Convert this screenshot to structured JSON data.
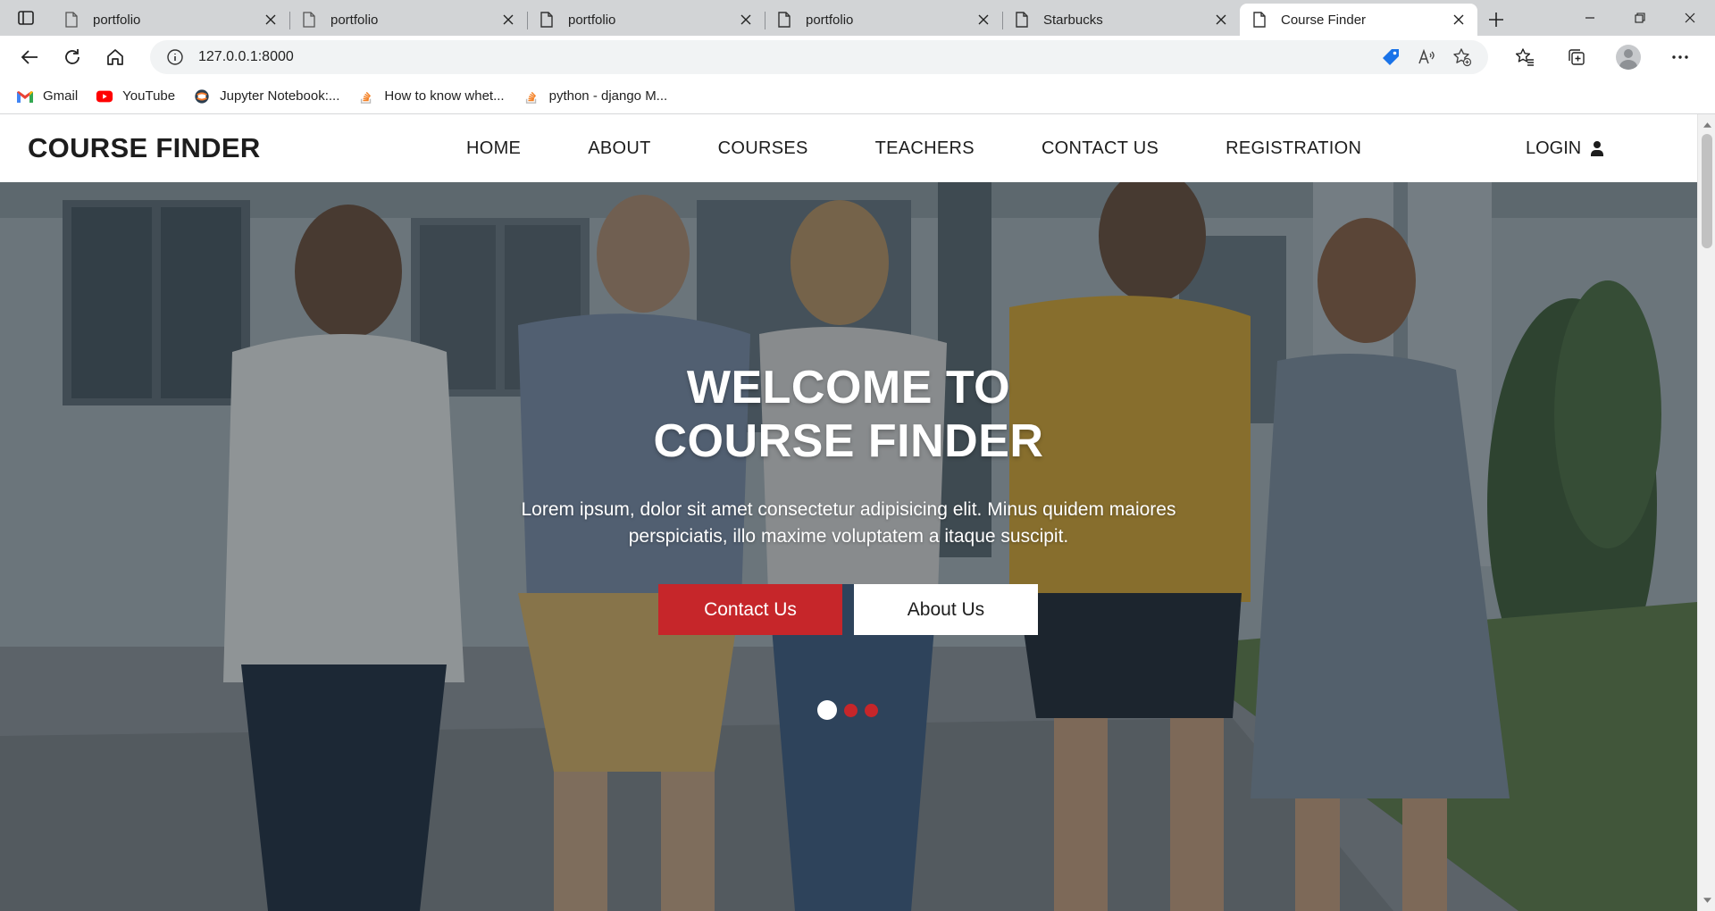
{
  "browser": {
    "tabs": [
      {
        "title": "portfolio",
        "icon": "page-icon",
        "active": false
      },
      {
        "title": "portfolio",
        "icon": "page-icon",
        "active": false
      },
      {
        "title": "portfolio",
        "icon": "page-icon",
        "active": false
      },
      {
        "title": "portfolio",
        "icon": "page-icon",
        "active": false
      },
      {
        "title": "Starbucks",
        "icon": "page-icon",
        "active": false
      },
      {
        "title": "Course Finder",
        "icon": "page-icon",
        "active": true
      }
    ],
    "address": {
      "url": "127.0.0.1:8000"
    },
    "bookmarks": [
      {
        "label": "Gmail",
        "icon": "gmail-icon"
      },
      {
        "label": "YouTube",
        "icon": "youtube-icon"
      },
      {
        "label": "Jupyter Notebook:...",
        "icon": "jupyter-icon"
      },
      {
        "label": "How to know whet...",
        "icon": "stackoverflow-icon"
      },
      {
        "label": "python - django M...",
        "icon": "stackoverflow-icon"
      }
    ]
  },
  "site": {
    "brand": "COURSE FINDER",
    "menu": [
      {
        "label": "HOME"
      },
      {
        "label": "ABOUT"
      },
      {
        "label": "COURSES"
      },
      {
        "label": "TEACHERS"
      },
      {
        "label": "CONTACT US"
      },
      {
        "label": "REGISTRATION"
      }
    ],
    "login": {
      "label": "LOGIN",
      "icon": "user-icon"
    },
    "hero": {
      "title_line1": "WELCOME TO",
      "title_line2": "COURSE FINDER",
      "text_line1": "Lorem ipsum, dolor sit amet consectetur adipisicing elit. Minus quidem maiores",
      "text_line2": "perspiciatis, illo maxime voluptatem a itaque suscipit.",
      "primary_button": "Contact Us",
      "secondary_button": "About Us",
      "slides": 3,
      "active_slide": 1
    },
    "colors": {
      "accent": "#c6262a",
      "text": "#1d1d1d",
      "nav_bg": "#ffffff"
    }
  }
}
